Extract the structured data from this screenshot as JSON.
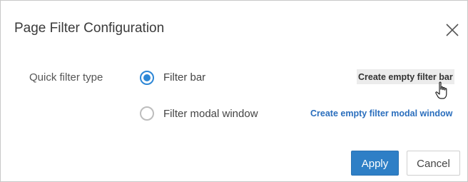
{
  "dialog": {
    "title": "Page Filter Configuration",
    "close_icon": "close-icon"
  },
  "form": {
    "field_label": "Quick filter type",
    "options": [
      {
        "label": "Filter bar",
        "selected": true,
        "action_label": "Create empty filter bar"
      },
      {
        "label": "Filter modal window",
        "selected": false,
        "action_label": "Create empty filter modal window"
      }
    ]
  },
  "footer": {
    "apply_label": "Apply",
    "cancel_label": "Cancel"
  },
  "colors": {
    "accent": "#2d87d6",
    "link": "#2a6ebd",
    "primary_button": "#2e7fc6"
  },
  "cursor_icon": "hand-pointer-icon"
}
